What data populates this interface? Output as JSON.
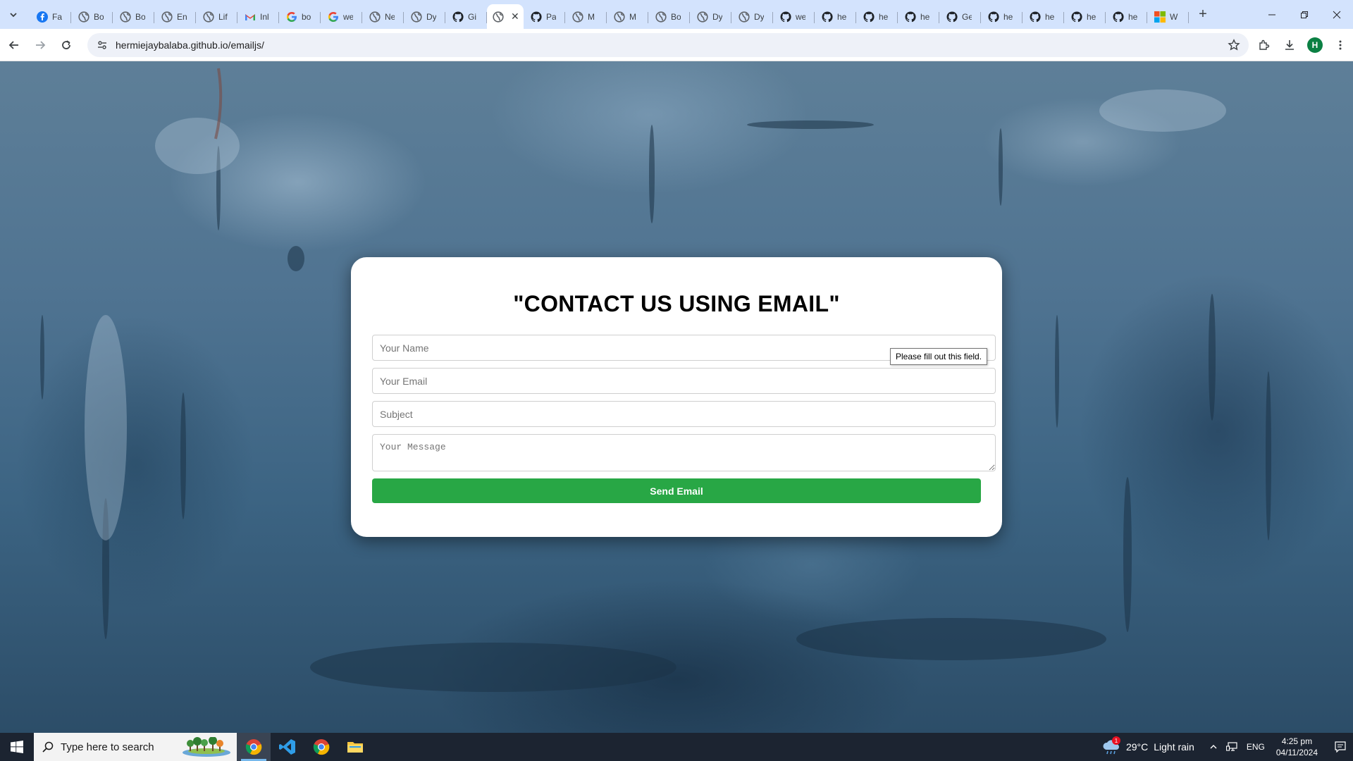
{
  "browser": {
    "tabs": [
      {
        "label": "Fa",
        "icon": "facebook-icon"
      },
      {
        "label": "Bo",
        "icon": "globe-icon"
      },
      {
        "label": "Bo",
        "icon": "globe-icon"
      },
      {
        "label": "En",
        "icon": "globe-icon"
      },
      {
        "label": "Lif",
        "icon": "globe-icon"
      },
      {
        "label": "Inl",
        "icon": "gmail-icon"
      },
      {
        "label": "bo",
        "icon": "google-icon"
      },
      {
        "label": "we",
        "icon": "google-icon"
      },
      {
        "label": "Ne",
        "icon": "globe-icon"
      },
      {
        "label": "Dy",
        "icon": "globe-icon"
      },
      {
        "label": "Gi",
        "icon": "github-icon"
      },
      {
        "label": "",
        "icon": "globe-icon",
        "active": true
      },
      {
        "label": "Pa",
        "icon": "github-icon"
      },
      {
        "label": "M",
        "icon": "globe-icon"
      },
      {
        "label": "M",
        "icon": "globe-icon"
      },
      {
        "label": "Bo",
        "icon": "globe-icon"
      },
      {
        "label": "Dy",
        "icon": "globe-icon"
      },
      {
        "label": "Dy",
        "icon": "globe-icon"
      },
      {
        "label": "we",
        "icon": "github-icon"
      },
      {
        "label": "he",
        "icon": "github-icon"
      },
      {
        "label": "he",
        "icon": "github-icon"
      },
      {
        "label": "he",
        "icon": "github-icon"
      },
      {
        "label": "Ge",
        "icon": "github-icon"
      },
      {
        "label": "he",
        "icon": "github-icon"
      },
      {
        "label": "he",
        "icon": "github-icon"
      },
      {
        "label": "he",
        "icon": "github-icon"
      },
      {
        "label": "he",
        "icon": "github-icon"
      },
      {
        "label": "W",
        "icon": "microsoft-icon"
      }
    ],
    "url": "hermiejaybalaba.github.io/emailjs/",
    "profile_initial": "H"
  },
  "page": {
    "heading": "\"CONTACT US USING EMAIL\"",
    "fields": {
      "name_placeholder": "Your Name",
      "email_placeholder": "Your Email",
      "subject_placeholder": "Subject",
      "message_placeholder": "Your Message"
    },
    "send_label": "Send Email",
    "validation_tooltip": "Please fill out this field."
  },
  "taskbar": {
    "search_placeholder": "Type here to search",
    "weather": {
      "temp": "29°C",
      "desc": "Light rain",
      "badge": "1"
    },
    "language": "ENG",
    "time": "4:25 pm",
    "date": "04/11/2024"
  },
  "colors": {
    "send_button": "#28a745",
    "tabstrip": "#d3e3fd",
    "taskbar": "#1c2431"
  }
}
